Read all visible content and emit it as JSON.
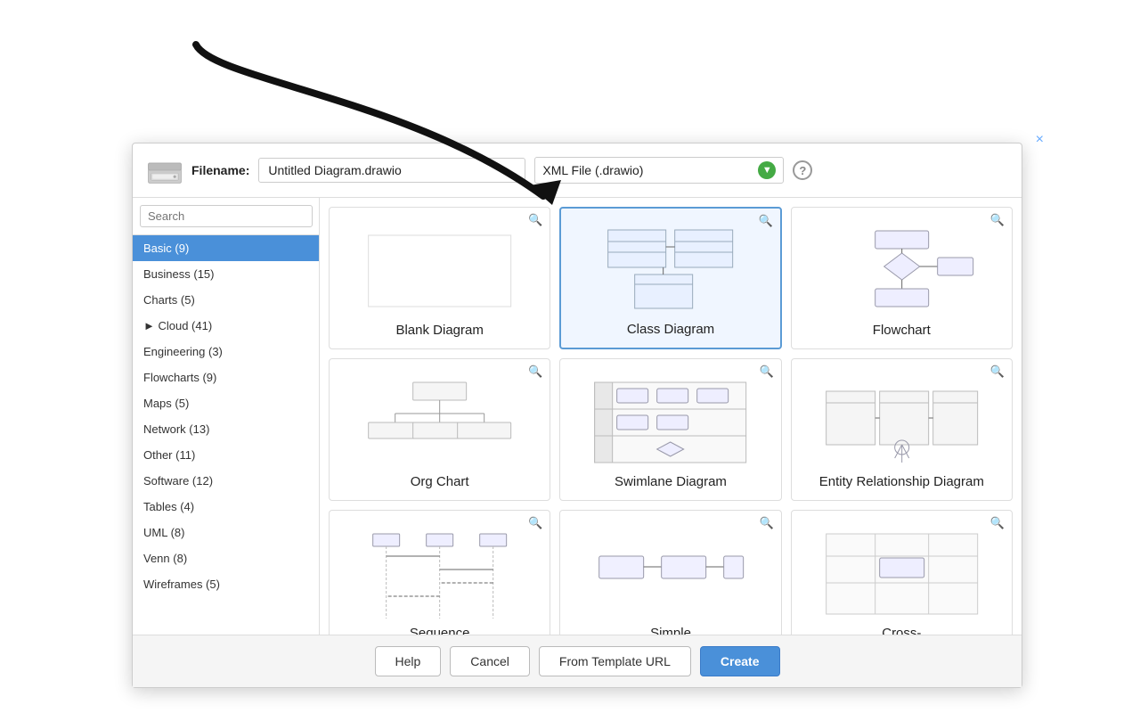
{
  "header": {
    "filename_label": "Filename:",
    "filename_value": "Untitled Diagram.drawio",
    "filetype_value": "XML File (.drawio)",
    "help_text": "?",
    "close_text": "×"
  },
  "search": {
    "placeholder": "Search",
    "icon": "🔍"
  },
  "sidebar": {
    "items": [
      {
        "label": "Basic (9)",
        "active": true
      },
      {
        "label": "Business (15)",
        "active": false
      },
      {
        "label": "Charts (5)",
        "active": false
      },
      {
        "label": "► Cloud (41)",
        "active": false
      },
      {
        "label": "Engineering (3)",
        "active": false
      },
      {
        "label": "Flowcharts (9)",
        "active": false
      },
      {
        "label": "Maps (5)",
        "active": false
      },
      {
        "label": "Network (13)",
        "active": false
      },
      {
        "label": "Other (11)",
        "active": false
      },
      {
        "label": "Software (12)",
        "active": false
      },
      {
        "label": "Tables (4)",
        "active": false
      },
      {
        "label": "UML (8)",
        "active": false
      },
      {
        "label": "Venn (8)",
        "active": false
      },
      {
        "label": "Wireframes (5)",
        "active": false
      }
    ]
  },
  "templates": [
    {
      "id": "blank",
      "label": "Blank\nDiagram",
      "selected": false,
      "preview_type": "blank"
    },
    {
      "id": "class",
      "label": "Class\nDiagram",
      "selected": true,
      "preview_type": "class"
    },
    {
      "id": "flowchart",
      "label": "Flowchart",
      "selected": false,
      "preview_type": "flowchart"
    },
    {
      "id": "orgchart",
      "label": "Org Chart",
      "selected": false,
      "preview_type": "orgchart"
    },
    {
      "id": "swimlane",
      "label": "Swimlane\nDiagram",
      "selected": false,
      "preview_type": "swimlane"
    },
    {
      "id": "erd",
      "label": "Entity\nRelationship\nDiagram",
      "selected": false,
      "preview_type": "erd"
    },
    {
      "id": "sequence",
      "label": "Sequence",
      "selected": false,
      "preview_type": "sequence"
    },
    {
      "id": "simple",
      "label": "Simple",
      "selected": false,
      "preview_type": "simple"
    },
    {
      "id": "cross",
      "label": "Cross-",
      "selected": false,
      "preview_type": "cross"
    }
  ],
  "footer": {
    "help_label": "Help",
    "cancel_label": "Cancel",
    "template_url_label": "From Template URL",
    "create_label": "Create"
  }
}
